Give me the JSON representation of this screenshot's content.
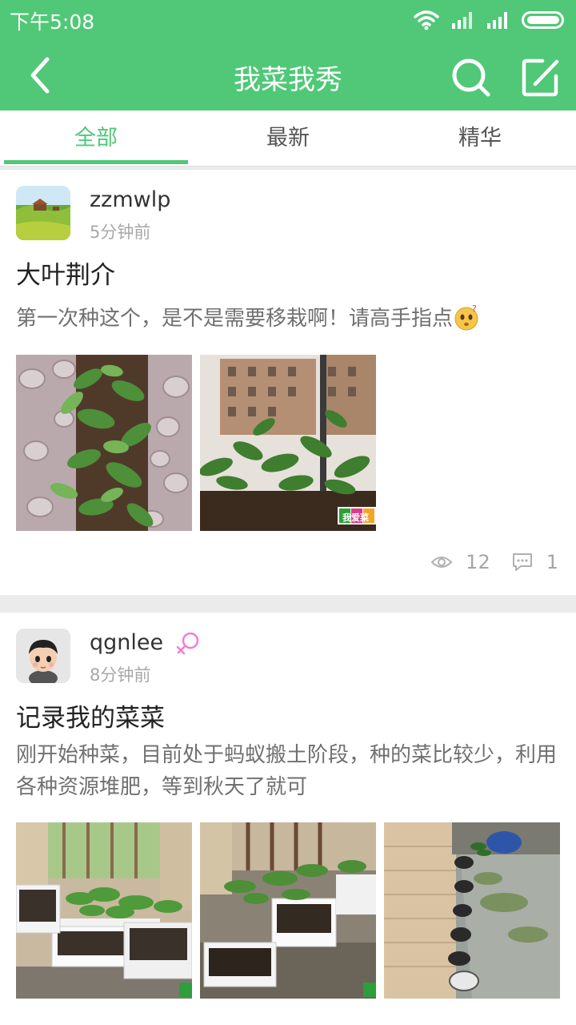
{
  "status": {
    "time": "下午5:08"
  },
  "header": {
    "title": "我菜我秀"
  },
  "tabs": [
    {
      "label": "全部"
    },
    {
      "label": "最新"
    },
    {
      "label": "精华"
    }
  ],
  "posts": [
    {
      "username": "zzmwlp",
      "time": "5分钟前",
      "title": "大叶荆介",
      "body": "第一次种这个，是不是需要移栽啊！请高手指点",
      "views": "12",
      "comments": "1",
      "watermark": "我爱菜"
    },
    {
      "username": "qgnlee",
      "time": "8分钟前",
      "title": "记录我的菜菜",
      "body": "刚开始种菜，目前处于蚂蚁搬土阶段，种的菜比较少，利用各种资源堆肥，等到秋天了就可",
      "watermark": "我"
    }
  ],
  "colors": {
    "accent": "#50c877"
  }
}
